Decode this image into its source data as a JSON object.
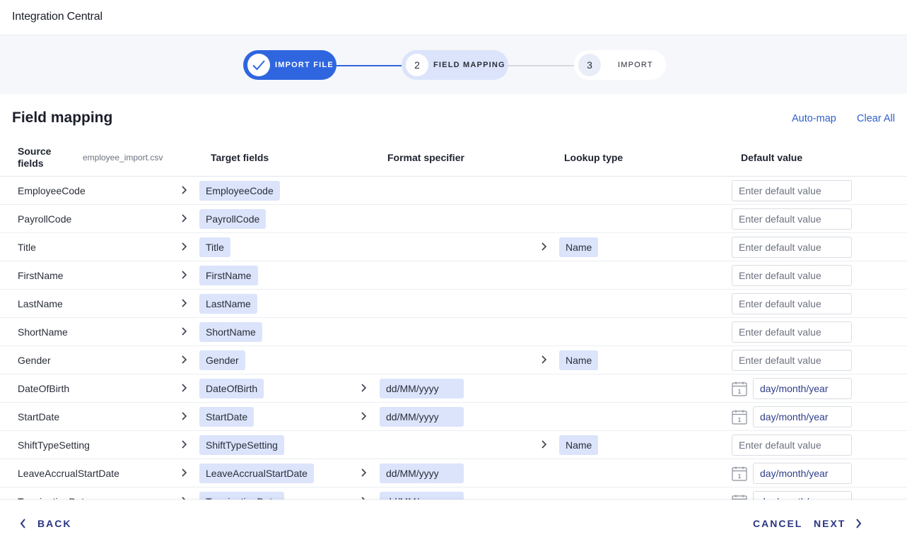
{
  "app": {
    "title": "Integration Central"
  },
  "stepper": {
    "steps": [
      {
        "number": "",
        "label": "IMPORT FILE",
        "state": "completed",
        "icon": "check-icon"
      },
      {
        "number": "2",
        "label": "FIELD MAPPING",
        "state": "active"
      },
      {
        "number": "3",
        "label": "IMPORT",
        "state": "pending"
      }
    ]
  },
  "section": {
    "title": "Field mapping",
    "automap_label": "Auto-map",
    "clear_label": "Clear All"
  },
  "columns": {
    "source": "Source fields",
    "file": "employee_import.csv",
    "target": "Target fields",
    "format": "Format specifier",
    "lookup": "Lookup type",
    "default": "Default value"
  },
  "placeholders": {
    "default": "Enter default value",
    "date": "day/month/year"
  },
  "rows": [
    {
      "source": "EmployeeCode",
      "target": "EmployeeCode",
      "format": "",
      "lookup": "",
      "default_type": "text"
    },
    {
      "source": "PayrollCode",
      "target": "PayrollCode",
      "format": "",
      "lookup": "",
      "default_type": "text"
    },
    {
      "source": "Title",
      "target": "Title",
      "format": "",
      "lookup": "Name",
      "default_type": "text"
    },
    {
      "source": "FirstName",
      "target": "FirstName",
      "format": "",
      "lookup": "",
      "default_type": "text"
    },
    {
      "source": "LastName",
      "target": "LastName",
      "format": "",
      "lookup": "",
      "default_type": "text"
    },
    {
      "source": "ShortName",
      "target": "ShortName",
      "format": "",
      "lookup": "",
      "default_type": "text"
    },
    {
      "source": "Gender",
      "target": "Gender",
      "format": "",
      "lookup": "Name",
      "default_type": "text"
    },
    {
      "source": "DateOfBirth",
      "target": "DateOfBirth",
      "format": "dd/MM/yyyy",
      "lookup": "",
      "default_type": "date"
    },
    {
      "source": "StartDate",
      "target": "StartDate",
      "format": "dd/MM/yyyy",
      "lookup": "",
      "default_type": "date"
    },
    {
      "source": "ShiftTypeSetting",
      "target": "ShiftTypeSetting",
      "format": "",
      "lookup": "Name",
      "default_type": "text"
    },
    {
      "source": "LeaveAccrualStartDate",
      "target": "LeaveAccrualStartDate",
      "format": "dd/MM/yyyy",
      "lookup": "",
      "default_type": "date"
    },
    {
      "source": "TerminationDate",
      "target": "TerminationDate",
      "format": "dd/MM/yyyy",
      "lookup": "",
      "default_type": "date"
    }
  ],
  "calendar_icon_day": "1",
  "footer": {
    "back_label": "BACK",
    "cancel_label": "CANCEL",
    "next_label": "NEXT"
  },
  "colors": {
    "primary": "#2f66e0",
    "chip": "#dbe4fb",
    "link": "#2f5fcc",
    "footer_text": "#2a3682"
  }
}
